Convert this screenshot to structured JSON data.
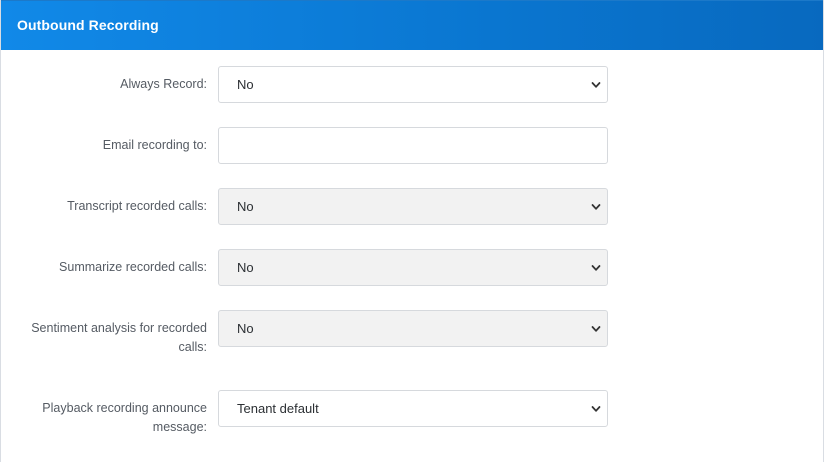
{
  "panel": {
    "title": "Outbound Recording"
  },
  "fields": {
    "always_record": {
      "label": "Always Record:",
      "value": "No"
    },
    "email_recording_to": {
      "label": "Email recording to:",
      "value": ""
    },
    "transcript": {
      "label": "Transcript recorded calls:",
      "value": "No"
    },
    "summarize": {
      "label": "Summarize recorded calls:",
      "value": "No"
    },
    "sentiment": {
      "label": "Sentiment analysis for recorded calls:",
      "value": "No"
    },
    "playback": {
      "label": "Playback recording announce message:",
      "value": "Tenant default"
    }
  }
}
